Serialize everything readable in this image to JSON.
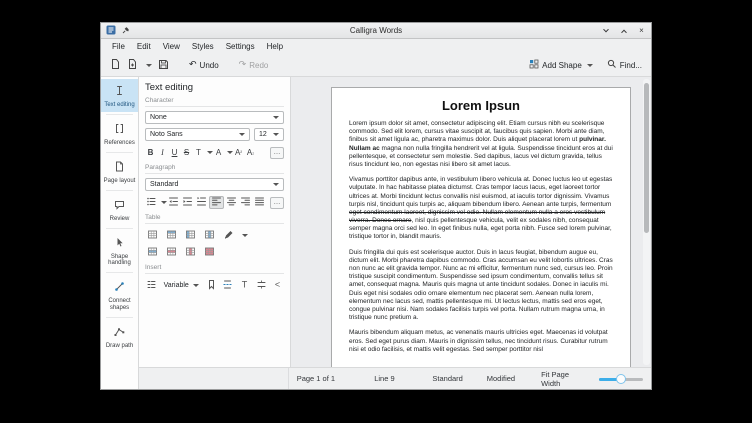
{
  "window": {
    "title": "Calligra Words"
  },
  "titlebar": {
    "close_glyph": "×"
  },
  "menubar": {
    "items": [
      "File",
      "Edit",
      "View",
      "Styles",
      "Settings",
      "Help"
    ]
  },
  "toolbar": {
    "undo_glyph": "↶",
    "undo_label": "Undo",
    "redo_glyph": "↷",
    "redo_label": "Redo",
    "add_shape_label": "Add Shape",
    "find_label": "Find..."
  },
  "sidebar": {
    "tabs": [
      {
        "id": "text-editing",
        "label": "Text editing",
        "icon": "text-edit",
        "selected": true
      },
      {
        "id": "references",
        "label": "References",
        "icon": "references",
        "selected": false
      },
      {
        "id": "page-layout",
        "label": "Page layout",
        "icon": "page",
        "selected": false
      },
      {
        "id": "review",
        "label": "Review",
        "icon": "review",
        "selected": false
      },
      {
        "id": "shape-handling",
        "label": "Shape handling",
        "icon": "cursor",
        "selected": false
      },
      {
        "id": "connect-shapes",
        "label": "Connect shapes",
        "icon": "connect",
        "selected": false
      },
      {
        "id": "draw-path",
        "label": "Draw path",
        "icon": "path",
        "selected": false
      }
    ]
  },
  "panel": {
    "title": "Text editing",
    "character": {
      "label": "Character",
      "style_value": "None",
      "font_family": "Noto Sans",
      "font_size": "12",
      "buttons": [
        {
          "name": "bold-button",
          "glyph": "B",
          "cls": "b"
        },
        {
          "name": "italic-button",
          "glyph": "I",
          "cls": "i"
        },
        {
          "name": "underline-button",
          "glyph": "U",
          "cls": "u"
        },
        {
          "name": "strikethrough-button",
          "glyph": "S",
          "cls": "s"
        },
        {
          "name": "text-position-button",
          "glyph": "T",
          "dropdown": true
        },
        {
          "name": "font-color-button",
          "glyph": "A",
          "dropdown": true
        },
        {
          "name": "superscript-button",
          "glyph": "A",
          "suffix": "²"
        },
        {
          "name": "subscript-button",
          "glyph": "A",
          "suffix": "₂"
        }
      ],
      "more_label": "…"
    },
    "paragraph": {
      "label": "Paragraph",
      "style_value": "Standard",
      "buttons": [
        {
          "name": "list-style-button",
          "icon": "list",
          "dropdown": true
        },
        {
          "name": "indent-less-button",
          "icon": "indent-less"
        },
        {
          "name": "indent-more-button",
          "icon": "indent-more"
        },
        {
          "name": "first-line-indent-button",
          "icon": "indent-first"
        },
        {
          "name": "align-left-button",
          "icon": "align-left",
          "selected": true
        },
        {
          "name": "align-center-button",
          "icon": "align-center"
        },
        {
          "name": "align-right-button",
          "icon": "align-right"
        },
        {
          "name": "align-justify-button",
          "icon": "align-justify"
        }
      ],
      "more_label": "…"
    },
    "table": {
      "label": "Table",
      "row1": [
        {
          "name": "insert-table-button",
          "icon": "insert-table"
        },
        {
          "name": "insert-row-button",
          "icon": "insert-row"
        },
        {
          "name": "insert-column-button",
          "icon": "insert-column"
        },
        {
          "name": "merge-cells-button",
          "icon": "merge-cells"
        },
        {
          "name": "border-pen-button",
          "icon": "border-pen",
          "dropdown": true
        }
      ],
      "row2": [
        {
          "name": "split-cells-button",
          "icon": "split-cells"
        },
        {
          "name": "delete-row-button",
          "icon": "delete-row"
        },
        {
          "name": "delete-column-button",
          "icon": "delete-column"
        },
        {
          "name": "delete-table-button",
          "icon": "delete-table"
        }
      ]
    },
    "insert": {
      "label": "Insert",
      "variable_label": "Variable",
      "lead_button": {
        "name": "insert-index-button",
        "icon": "insert-toc"
      },
      "buttons": [
        {
          "name": "insert-bookmark-button",
          "icon": "insert-bookmark"
        },
        {
          "name": "insert-page-break-button",
          "icon": "insert-page-break"
        },
        {
          "name": "insert-text-button",
          "icon": "insert-text-variable"
        },
        {
          "name": "insert-spacing-button",
          "icon": "insert-spacing"
        },
        {
          "name": "insert-special-char-button",
          "icon": "insert-special-char"
        }
      ]
    }
  },
  "document": {
    "title": "Lorem Ipsun",
    "paragraphs": [
      {
        "segments": [
          {
            "t": "Lorem ipsum dolor sit amet, consectetur adipiscing elit. Etiam cursus nibh eu scelerisque commodo. Sed elit lorem, cursus vitae suscipit at, faucibus quis sapien. Morbi ante diam, finibus sit amet ligula ac, pharetra maximus dolor. Duis aliquet placerat lorem ut "
          },
          {
            "t": "pulvinar. Nullam ac",
            "s": "bold"
          },
          {
            "t": " magna non nulla fringilla hendrerit vel at ligula. Suspendisse tincidunt eros at dui pellentesque, et consectetur sem molestie. Sed dapibus, lacus vel dictum gravida, tellus risus tincidunt leo, non egestas nisi libero sit amet lacus."
          }
        ]
      },
      {
        "segments": [
          {
            "t": "Vivamus porttitor dapibus ante, in vestibulum libero vehicula at. Donec luctus leo ut egestas vulputate. In hac habitasse platea dictumst. Cras tempor lacus lacus, eget laoreet tortor ultrices at. Morbi tincidunt lectus convallis nisl euismod, at iaculis tortor dignissim. Vivamus turpis nisl, tincidunt quis turpis ac, aliquam bibendum libero. Aenean ante turpis, fermentum "
          },
          {
            "t": "eget condimentum laoreet, dignissim vel odio. Nullam elementum nulla a eros vestibulum viverra. Donec ornare",
            "s": "strike"
          },
          {
            "t": ", nisl quis pellentesque vehicula, velit ex sodales nibh, consequat semper magna orci sed leo. In eget finibus nulla, eget porta nibh. Fusce sed lorem pulvinar, tristique tortor in, blandit mauris."
          }
        ]
      },
      {
        "segments": [
          {
            "t": "Duis fringilla dui quis est scelerisque auctor. Duis in lacus feugiat, bibendum augue eu, dictum elit. Morbi pharetra dapibus commodo. Cras accumsan eu velit lobortis ultrices. Cras non nunc ac elit gravida tempor. Nunc ac mi efficitur, fermentum nunc sed, cursus leo. Proin tristique suscipit condimentum. Suspendisse sed ipsum condimentum, convallis tellus sit amet, consequat magna. Mauris quis magna ut ante tincidunt sodales. Donec in iaculis mi. Duis eget nisi sodales odio ornare elementum nec placerat sem. Aenean nulla lorem, elementum nec lacus sed, mattis pellentesque mi. Ut lectus lectus, mattis sed eros eget, congue pulvinar nisi. Nam sodales facilisis turpis vel porta. Nullam rutrum magna urna, in tristique nunc pretium a."
          }
        ]
      },
      {
        "segments": [
          {
            "t": "Mauris bibendum aliquam metus, ac venenatis mauris ultricies eget. Maecenas id volutpat eros. Sed eget purus diam. Mauris in dignissim tellus, nec tincidunt risus. Curabitur rutrum nisi et odio facilisis, et mattis velit egestas. Sed semper porttitor nisl"
          }
        ]
      }
    ]
  },
  "statusbar": {
    "page": "Page 1 of 1",
    "line": "Line 9",
    "style": "Standard",
    "modified": "Modified",
    "zoom_mode": "Fit Page Width",
    "zoom_slider_fraction": 0.5
  },
  "colors": {
    "accent": "#3daee9",
    "selected_tab_bg": "#c9e3f5",
    "table_insert_blue": "#7fb3d9",
    "table_delete_red": "#e08591"
  }
}
